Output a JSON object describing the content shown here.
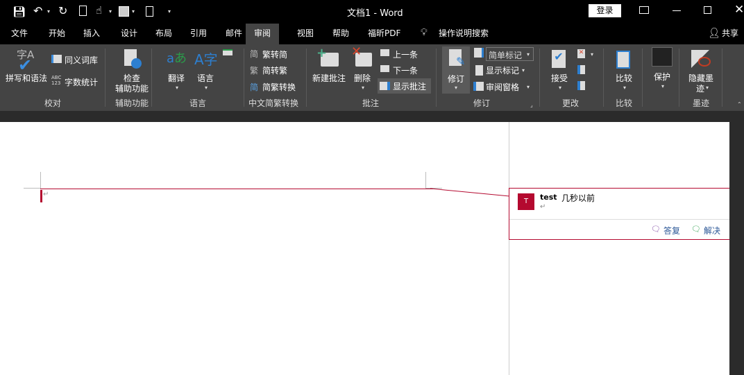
{
  "title": "文档1  -  Word",
  "login_label": "登录",
  "tabs": [
    "文件",
    "开始",
    "插入",
    "设计",
    "布局",
    "引用",
    "邮件",
    "审阅",
    "视图",
    "帮助",
    "福昕PDF"
  ],
  "search_label": "操作说明搜索",
  "share_label": "共享",
  "ribbon": {
    "proofing": {
      "spelling": "拼写和语法",
      "thesaurus": "同义词库",
      "wordcount": "字数统计",
      "group": "校对"
    },
    "accessibility": {
      "check": "检查",
      "check2": "辅助功能",
      "group": "辅助功能"
    },
    "language": {
      "translate": "翻译",
      "language": "语言",
      "group": "语言"
    },
    "chinese": {
      "t2s": "繁转简",
      "s2t": "简转繁",
      "convert": "简繁转换",
      "group": "中文简繁转换"
    },
    "comments": {
      "new": "新建批注",
      "delete": "删除",
      "prev": "上一条",
      "next": "下一条",
      "show": "显示批注",
      "group": "批注"
    },
    "tracking": {
      "track": "修订",
      "markup_select": "简单标记",
      "show_markup": "显示标记",
      "pane": "审阅窗格",
      "group": "修订"
    },
    "changes": {
      "accept": "接受",
      "group": "更改"
    },
    "compare": {
      "compare": "比较",
      "group": "比较"
    },
    "protect": {
      "protect": "保护"
    },
    "ink": {
      "hide": "隐藏墨",
      "hide2": "迹",
      "group": "墨迹"
    }
  },
  "comment": {
    "avatar": "T",
    "author": "test",
    "time": "几秒以前",
    "body": "↵",
    "reply": "答复",
    "resolve": "解决"
  },
  "colors": {
    "accent": "#b4092f"
  }
}
